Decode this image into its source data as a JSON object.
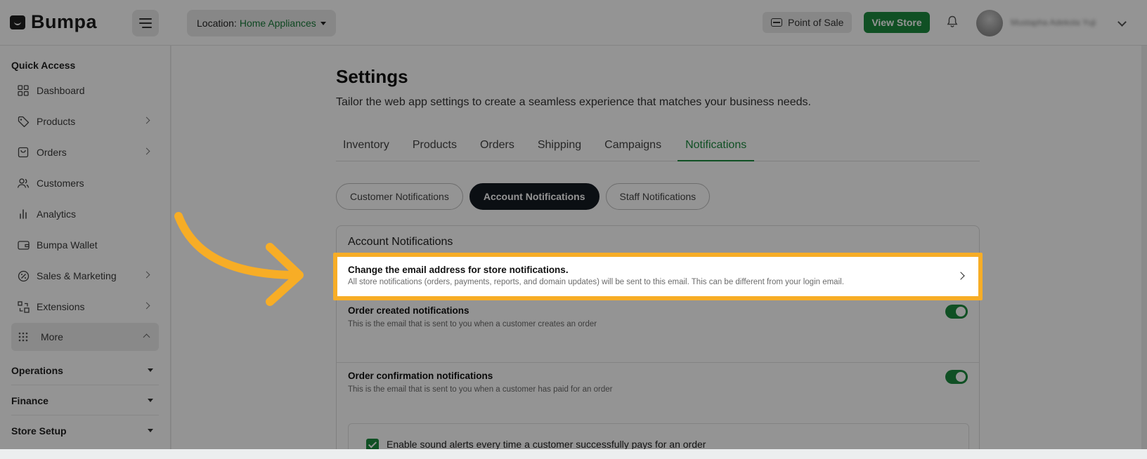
{
  "app": {
    "logo": "Bumpa"
  },
  "topbar": {
    "location_key": "Location:",
    "location_value": "Home Appliances",
    "pos_label": "Point of Sale",
    "view_store_label": "View Store",
    "user_name": "Mustapha Adekola Yuji"
  },
  "sidebar": {
    "quick_access": "Quick Access",
    "items": [
      {
        "label": "Dashboard",
        "icon": "grid-icon"
      },
      {
        "label": "Products",
        "icon": "tag-icon"
      },
      {
        "label": "Orders",
        "icon": "bag-icon"
      },
      {
        "label": "Customers",
        "icon": "users-icon"
      },
      {
        "label": "Analytics",
        "icon": "bar-chart-icon"
      },
      {
        "label": "Bumpa Wallet",
        "icon": "wallet-icon"
      },
      {
        "label": "Sales & Marketing",
        "icon": "percent-icon"
      },
      {
        "label": "Extensions",
        "icon": "extensions-icon"
      },
      {
        "label": "More",
        "icon": "dots-grid-icon"
      }
    ],
    "sections": [
      "Operations",
      "Finance",
      "Store Setup"
    ]
  },
  "settings": {
    "title": "Settings",
    "subtitle": "Tailor the web app settings to create a seamless experience that matches your business needs.",
    "tabs": [
      "Inventory",
      "Products",
      "Orders",
      "Shipping",
      "Campaigns",
      "Notifications"
    ],
    "active_tab": "Notifications",
    "pills": [
      "Customer Notifications",
      "Account Notifications",
      "Staff Notifications"
    ],
    "active_pill": "Account Notifications",
    "card_title": "Account Notifications",
    "rows": [
      {
        "title": "Change the email address for store notifications.",
        "desc": "All store notifications (orders, payments, reports, and domain updates) will be sent to this email. This can be different from your login email."
      },
      {
        "title": "Order created notifications",
        "desc": "This is the email that is sent to you when a customer creates an order",
        "enabled": true
      },
      {
        "title": "Order confirmation notifications",
        "desc": "This is the email that is sent to you when a customer has paid for an order",
        "enabled": true
      }
    ],
    "sound_alert_label": "Enable sound alerts every time a customer successfully pays for an order",
    "sound_alert_checked": true
  },
  "colors": {
    "accent": "#1d8a3f",
    "highlight": "#f7ad26",
    "dark_pill": "#141a22"
  }
}
